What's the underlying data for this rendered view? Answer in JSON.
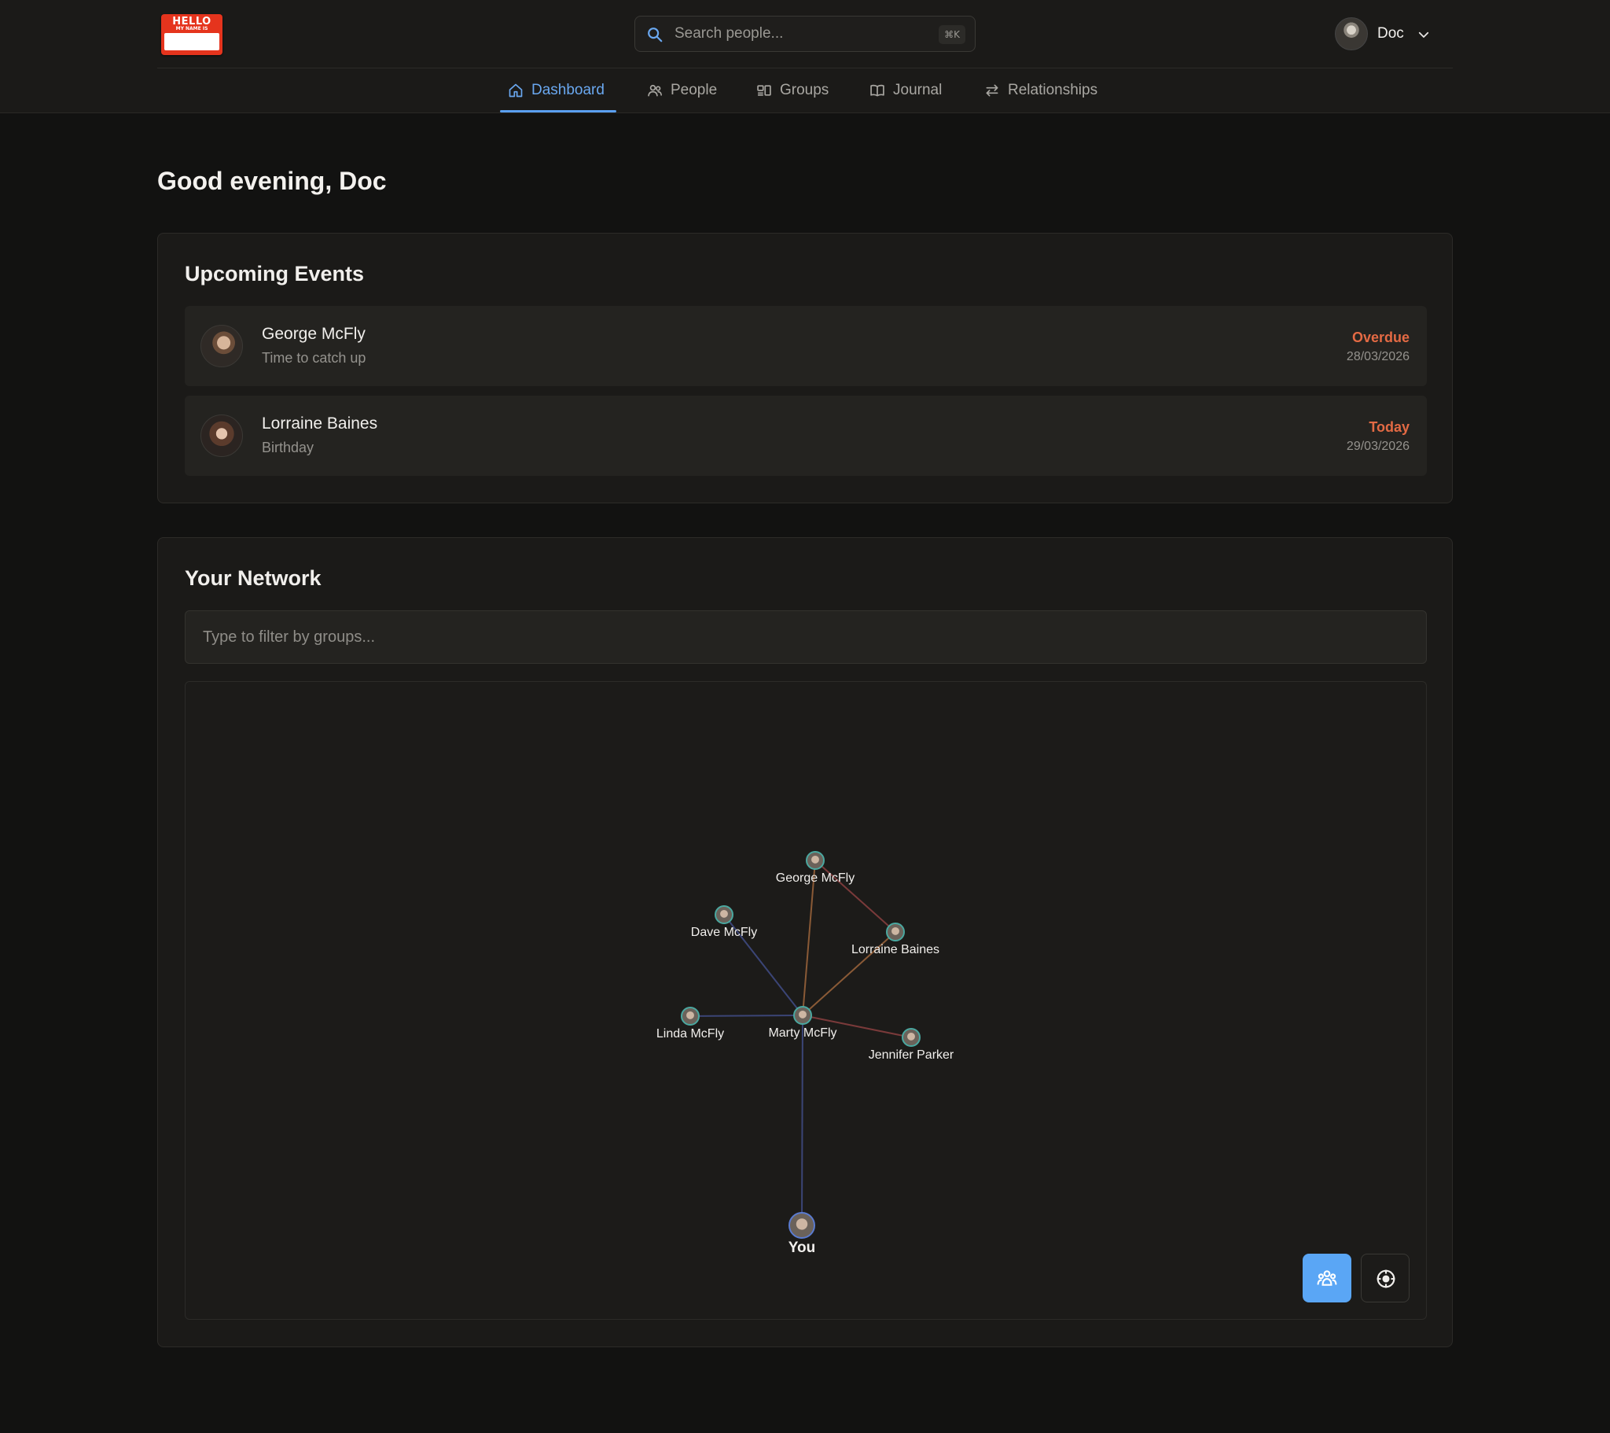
{
  "header": {
    "logo": {
      "line1": "HELLO",
      "line2": "MY NAME IS"
    },
    "search": {
      "placeholder": "Search people...",
      "shortcut": "⌘K"
    },
    "user": {
      "name": "Doc"
    }
  },
  "nav": {
    "items": [
      {
        "label": "Dashboard",
        "icon": "home-icon",
        "active": true
      },
      {
        "label": "People",
        "icon": "people-icon",
        "active": false
      },
      {
        "label": "Groups",
        "icon": "groups-icon",
        "active": false
      },
      {
        "label": "Journal",
        "icon": "book-icon",
        "active": false
      },
      {
        "label": "Relationships",
        "icon": "swap-arrows-icon",
        "active": false
      }
    ]
  },
  "greeting": "Good evening, Doc",
  "upcoming": {
    "title": "Upcoming Events",
    "events": [
      {
        "name": "George McFly",
        "subtitle": "Time to catch up",
        "status": "Overdue",
        "date": "28/03/2026"
      },
      {
        "name": "Lorraine Baines",
        "subtitle": "Birthday",
        "status": "Today",
        "date": "29/03/2026"
      }
    ],
    "status_color": "#e46a44"
  },
  "network": {
    "title": "Your Network",
    "filter_placeholder": "Type to filter by groups...",
    "nodes": [
      {
        "id": "george",
        "label": "George McFly"
      },
      {
        "id": "dave",
        "label": "Dave McFly"
      },
      {
        "id": "lorraine",
        "label": "Lorraine Baines"
      },
      {
        "id": "linda",
        "label": "Linda McFly"
      },
      {
        "id": "marty",
        "label": "Marty McFly"
      },
      {
        "id": "jennifer",
        "label": "Jennifer Parker"
      },
      {
        "id": "you",
        "label": "You"
      }
    ],
    "edges": [
      {
        "from": "george",
        "to": "marty",
        "color": "#8a5a36"
      },
      {
        "from": "george",
        "to": "lorraine",
        "color": "#7a3a3a"
      },
      {
        "from": "lorraine",
        "to": "marty",
        "color": "#8a5a36"
      },
      {
        "from": "dave",
        "to": "marty",
        "color": "#3b4576"
      },
      {
        "from": "linda",
        "to": "marty",
        "color": "#3b4576"
      },
      {
        "from": "jennifer",
        "to": "marty",
        "color": "#7a3a3a"
      },
      {
        "from": "you",
        "to": "marty",
        "color": "#3b4576"
      }
    ],
    "buttons": [
      {
        "icon": "people-group-icon",
        "active": true
      },
      {
        "icon": "crosshair-center-icon",
        "active": false
      }
    ],
    "accent": "#5aa6f5"
  }
}
